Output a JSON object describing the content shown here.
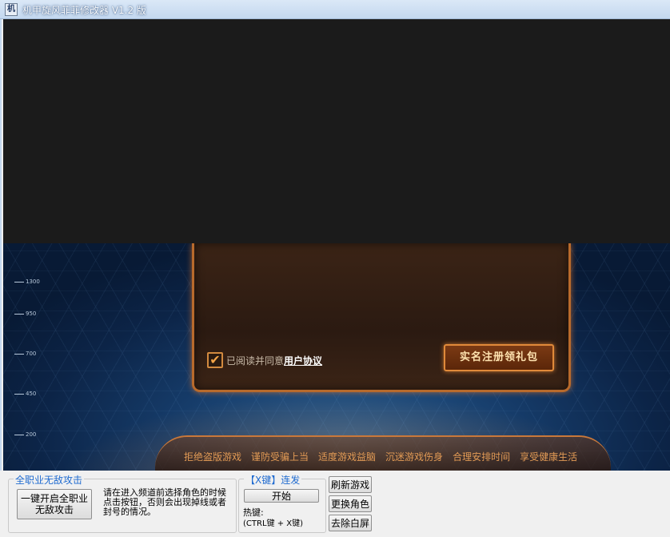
{
  "window": {
    "title": "机甲旋风菲菲修改器 V1.2 版",
    "icon_glyph": "机"
  },
  "game": {
    "scale_ticks": [
      "1300",
      "950",
      "700",
      "450",
      "200"
    ],
    "agree_prefix": "已阅读并同意",
    "agree_link": "用户协议",
    "register_button": "实名注册领礼包",
    "health_notice": [
      "拒绝盗版游戏",
      "谨防受骗上当",
      "适度游戏益脑",
      "沉迷游戏伤身",
      "合理安排时间",
      "享受健康生活"
    ]
  },
  "controls": {
    "invincible_group": {
      "legend": "全职业无敌攻击",
      "button_line1": "一键开启全职业",
      "button_line2": "无敌攻击",
      "description": "请在进入频道前选择角色的时候点击按钮，否则会出现掉线或者封号的情况。"
    },
    "x_key_group": {
      "legend": "【X键】连发",
      "start_button": "开始",
      "hotkey_label": "热键:",
      "hotkey_combo": "(CTRL键 + X键)"
    },
    "refresh_button": "刷新游戏",
    "change_role_button": "更换角色",
    "remove_white_button": "去除白屏"
  }
}
